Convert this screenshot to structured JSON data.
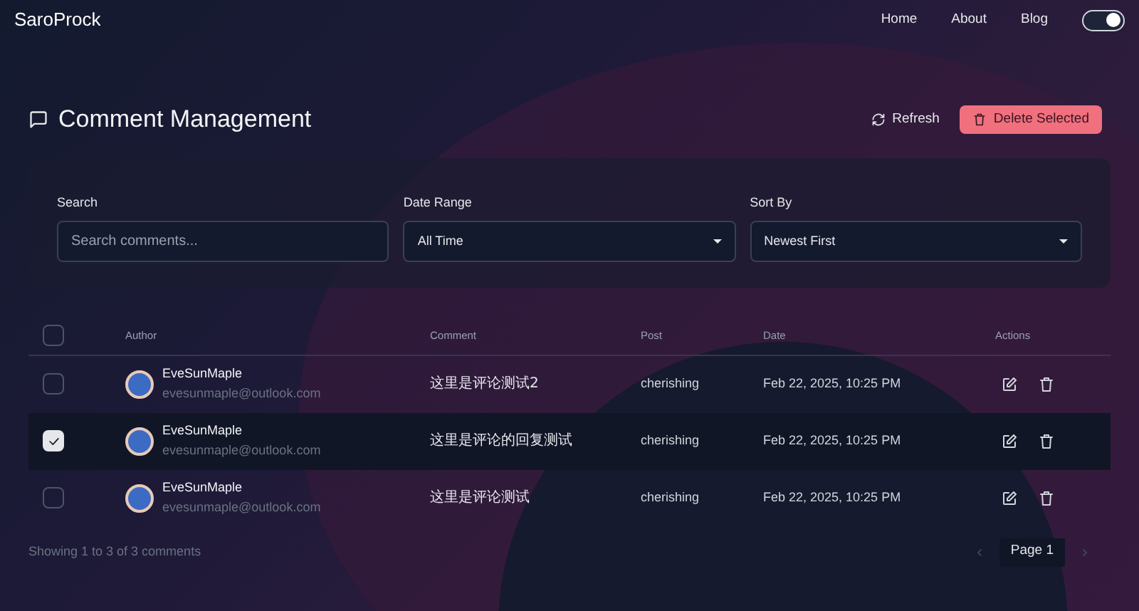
{
  "navbar": {
    "brand": "SaroProck",
    "links": [
      "Home",
      "About",
      "Blog"
    ],
    "theme_toggle": {
      "on": true
    }
  },
  "header": {
    "title": "Comment Management",
    "refresh": "Refresh",
    "delete_selected": "Delete Selected"
  },
  "filters": {
    "search": {
      "label": "Search",
      "placeholder": "Search comments..."
    },
    "date_range": {
      "label": "Date Range",
      "value": "All Time"
    },
    "sort_by": {
      "label": "Sort By",
      "value": "Newest First"
    }
  },
  "table": {
    "select_all": {
      "checked": false
    },
    "columns": [
      "Author",
      "Comment",
      "Post",
      "Date",
      "Actions"
    ],
    "rows": [
      {
        "selected": false,
        "author": "EveSunMaple",
        "email": "evesunmaple@outlook.com",
        "comment": "这里是评论测试2",
        "post": "cherishing",
        "date": "Feb 22, 2025, 10:25 PM"
      },
      {
        "selected": true,
        "author": "EveSunMaple",
        "email": "evesunmaple@outlook.com",
        "comment": "这里是评论的回复测试",
        "post": "cherishing",
        "date": "Feb 22, 2025, 10:25 PM"
      },
      {
        "selected": false,
        "author": "EveSunMaple",
        "email": "evesunmaple@outlook.com",
        "comment": "这里是评论测试",
        "post": "cherishing",
        "date": "Feb 22, 2025, 10:25 PM"
      }
    ]
  },
  "footer": {
    "summary": "Showing 1 to 3 of 3 comments",
    "page": "Page 1"
  }
}
